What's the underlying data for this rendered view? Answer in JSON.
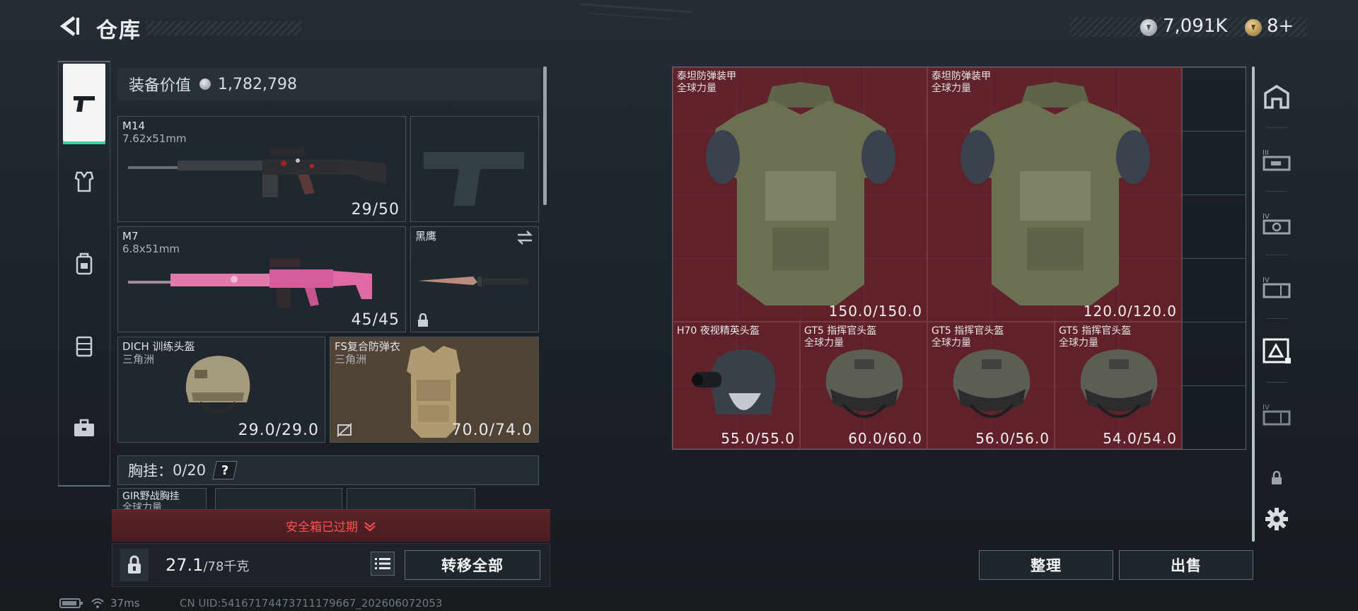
{
  "header": {
    "title": "仓库",
    "currency_silver": "7,091K",
    "currency_gold": "8+"
  },
  "left_tabs": [
    "weapon-tab",
    "armor-vest-tab",
    "backpack-tab",
    "chest-rig-tab",
    "toolbox-tab"
  ],
  "equipment": {
    "value_label": "装备价值",
    "value": "1,782,798",
    "primary": {
      "name": "M14",
      "caliber": "7.62x51mm",
      "ammo": "29/50"
    },
    "secondary": {
      "name": "M7",
      "caliber": "6.8x51mm",
      "ammo": "45/45"
    },
    "melee": {
      "name": "黑鹰"
    },
    "helmet": {
      "name": "DICH 训练头盔",
      "origin": "三角洲",
      "durability": "29.0/29.0"
    },
    "armor": {
      "name": "FS复合防弹衣",
      "origin": "三角洲",
      "durability": "70.0/74.0"
    },
    "chest_rig": {
      "label": "胸挂：",
      "capacity": "0/20",
      "help": "?"
    },
    "rig_item": {
      "name": "GIR野战胸挂",
      "origin": "全球力量"
    }
  },
  "safebox": {
    "expired_text": "安全箱已过期"
  },
  "bottom": {
    "weight": "27.1",
    "weight_max": "/78千克",
    "transfer_all": "转移全部"
  },
  "status": {
    "ping": "37ms",
    "uid": "CN UID:541671744737111796​67_202606072053"
  },
  "storage": {
    "items": [
      {
        "name": "泰坦防弹装甲",
        "origin": "全球力量",
        "durability": "150.0/150.0"
      },
      {
        "name": "泰坦防弹装甲",
        "origin": "全球力量",
        "durability": "120.0/120.0"
      },
      {
        "name": "H70 夜视精英头盔",
        "origin": "",
        "durability": "55.0/55.0"
      },
      {
        "name": "GT5 指挥官头盔",
        "origin": "全球力量",
        "durability": "60.0/60.0"
      },
      {
        "name": "GT5 指挥官头盔",
        "origin": "全球力量",
        "durability": "56.0/56.0"
      },
      {
        "name": "GT5 指挥官头盔",
        "origin": "全球力量",
        "durability": "54.0/54.0"
      }
    ],
    "sort_label": "整理",
    "sell_label": "出售"
  },
  "colors": {
    "accent": "#3fd0a0",
    "expired": "#ff5050",
    "item_bg": "#70222c"
  }
}
